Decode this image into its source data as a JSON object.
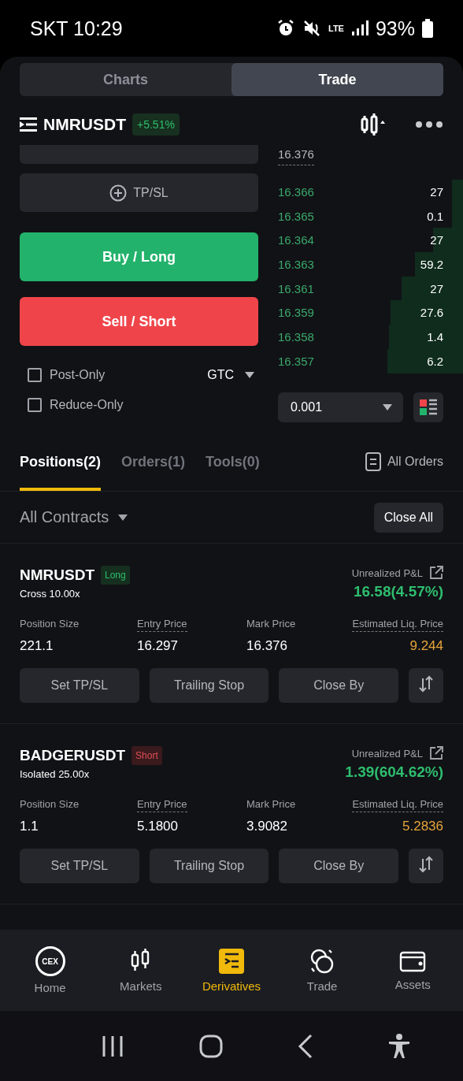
{
  "status_bar": {
    "carrier_time": "SKT 10:29",
    "network": "LTE",
    "battery": "93%"
  },
  "view_tabs": [
    {
      "label": "Charts",
      "selected": false
    },
    {
      "label": "Trade",
      "selected": true
    }
  ],
  "symbol": {
    "name": "NMRUSDT",
    "change": "+5.51%"
  },
  "order_form": {
    "tpsl": "TP/SL",
    "buy": "Buy / Long",
    "sell": "Sell / Short",
    "time_in_force": "GTC",
    "options": [
      {
        "label": "Post-Only",
        "checked": false
      },
      {
        "label": "Reduce-Only",
        "checked": false
      }
    ]
  },
  "order_book": {
    "mark_price": "16.376",
    "precision": "0.001",
    "bids": [
      {
        "price": "16.366",
        "size": "27"
      },
      {
        "price": "16.365",
        "size": "0.1"
      },
      {
        "price": "16.364",
        "size": "27"
      },
      {
        "price": "16.363",
        "size": "59.2"
      },
      {
        "price": "16.361",
        "size": "27"
      },
      {
        "price": "16.359",
        "size": "27.6"
      },
      {
        "price": "16.358",
        "size": "1.4"
      },
      {
        "price": "16.357",
        "size": "6.2"
      }
    ]
  },
  "position_tabs": [
    {
      "label": "Positions(2)",
      "selected": true
    },
    {
      "label": "Orders(1)",
      "selected": false
    },
    {
      "label": "Tools(0)",
      "selected": false
    }
  ],
  "all_orders": "All Orders",
  "filter": {
    "label": "All Contracts",
    "close_all": "Close All"
  },
  "positions": [
    {
      "symbol": "NMRUSDT",
      "kind": "long",
      "side_label": "Long",
      "margin": "Cross 10.00x",
      "pnl_label": "Unrealized P&L",
      "pnl": "16.58(4.57%)",
      "profit": true,
      "stats": [
        {
          "label": "Position Size",
          "value": "221.1",
          "dotted": false,
          "warning": false
        },
        {
          "label": "Entry Price",
          "value": "16.297",
          "dotted": true,
          "warning": false
        },
        {
          "label": "Mark Price",
          "value": "16.376",
          "dotted": false,
          "warning": false
        },
        {
          "label": "Estimated Liq. Price",
          "value": "9.244",
          "dotted": true,
          "warning": true
        }
      ],
      "actions": [
        "Set TP/SL",
        "Trailing Stop",
        "Close By"
      ]
    },
    {
      "symbol": "BADGERUSDT",
      "kind": "short",
      "side_label": "Short",
      "margin": "Isolated 25.00x",
      "pnl_label": "Unrealized P&L",
      "pnl": "1.39(604.62%)",
      "profit": true,
      "stats": [
        {
          "label": "Position Size",
          "value": "1.1",
          "dotted": false,
          "warning": false
        },
        {
          "label": "Entry Price",
          "value": "5.1800",
          "dotted": true,
          "warning": false
        },
        {
          "label": "Mark Price",
          "value": "3.9082",
          "dotted": false,
          "warning": false
        },
        {
          "label": "Estimated Liq. Price",
          "value": "5.2836",
          "dotted": true,
          "warning": true
        }
      ],
      "actions": [
        "Set TP/SL",
        "Trailing Stop",
        "Close By"
      ]
    }
  ],
  "bottom_nav": [
    {
      "label": "Home",
      "kind": "home",
      "logo": "CEX",
      "selected": false
    },
    {
      "label": "Markets",
      "kind": "markets",
      "selected": false
    },
    {
      "label": "Derivatives",
      "kind": "derivatives",
      "selected": true
    },
    {
      "label": "Trade",
      "kind": "trade",
      "selected": false
    },
    {
      "label": "Assets",
      "kind": "assets",
      "selected": false
    }
  ]
}
